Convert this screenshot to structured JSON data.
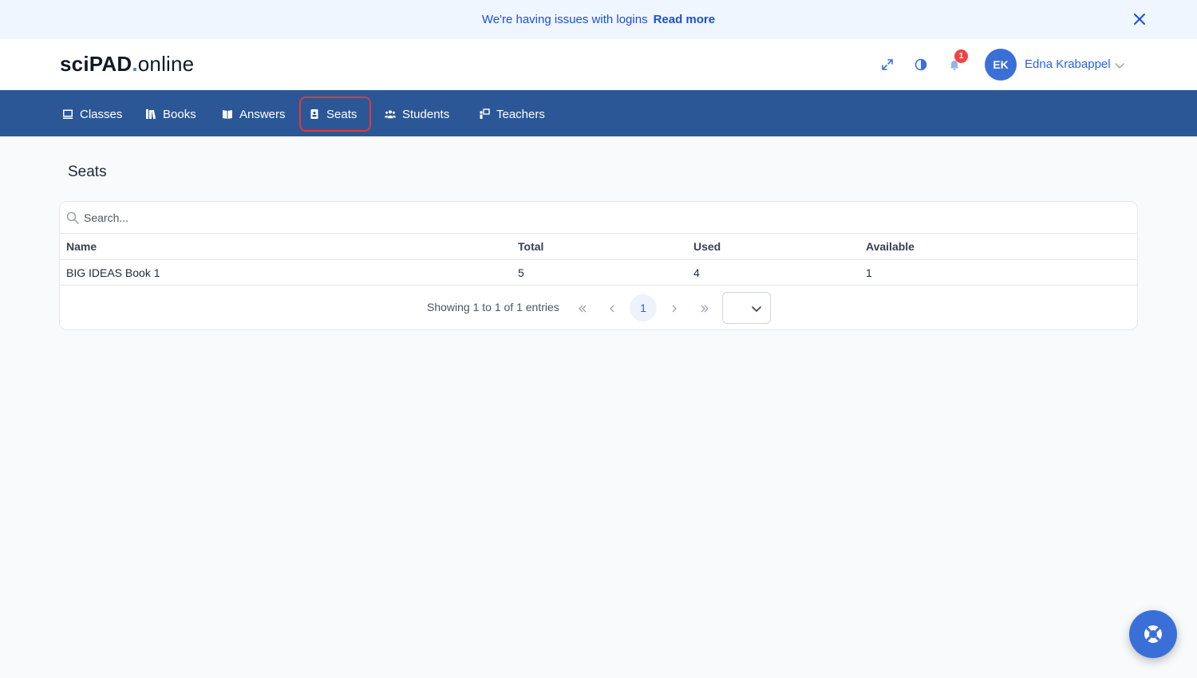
{
  "banner": {
    "message": "We're having issues with logins",
    "link_label": "Read more"
  },
  "header": {
    "logo_bold": "sciPAD",
    "logo_dot": ".",
    "logo_rest": "online",
    "notification_count": "1",
    "user_initials": "EK",
    "user_name": "Edna Krabappel",
    "icons": [
      "expand-icon",
      "contrast-icon",
      "bell-icon",
      "chevron-down-icon"
    ]
  },
  "nav": {
    "items": [
      {
        "label": "Classes",
        "icon": "classes-icon"
      },
      {
        "label": "Books",
        "icon": "books-icon"
      },
      {
        "label": "Answers",
        "icon": "answers-icon"
      },
      {
        "label": "Seats",
        "icon": "seats-icon",
        "active": true
      },
      {
        "label": "Students",
        "icon": "students-icon"
      },
      {
        "label": "Teachers",
        "icon": "teachers-icon"
      }
    ]
  },
  "main": {
    "title": "Seats",
    "search_placeholder": "Search...",
    "table": {
      "columns": [
        "Name",
        "Total",
        "Used",
        "Available"
      ],
      "rows": [
        [
          "BIG IDEAS Book 1",
          "5",
          "4",
          "1"
        ]
      ]
    },
    "pagination": {
      "summary": "Showing 1 to 1 of 1 entries",
      "current_page": "1",
      "page_size_value": ""
    }
  },
  "colors": {
    "nav_bg": "#2b5797",
    "accent": "#2563eb",
    "banner_bg": "#eff6ff",
    "badge": "#ef4444",
    "highlight_border": "#e03a3a"
  }
}
